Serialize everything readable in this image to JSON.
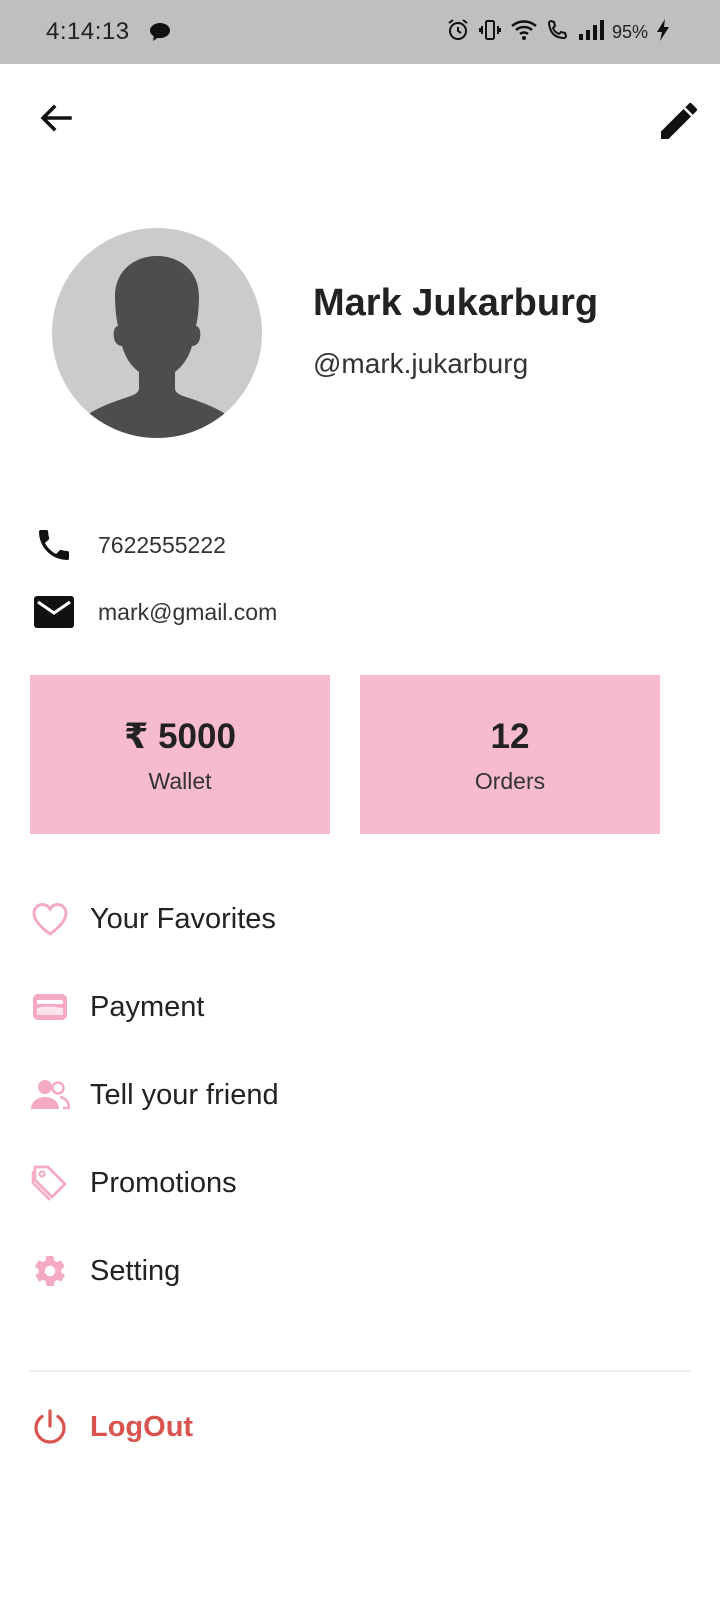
{
  "status_bar": {
    "time": "4:14:13",
    "battery": "95%",
    "icons": [
      "chat-icon",
      "alarm-icon",
      "vibrate-icon",
      "wifi-icon",
      "wifi-call-icon",
      "signal-icon",
      "charging-icon"
    ]
  },
  "app_bar": {
    "back_icon": "arrow-back-icon",
    "edit_icon": "edit-pencil-icon"
  },
  "profile": {
    "name": "Mark Jukarburg",
    "handle": "@mark.jukarburg",
    "avatar_icon": "person-silhouette-icon"
  },
  "contact": {
    "phone": "7622555222",
    "email": "mark@gmail.com"
  },
  "stats": [
    {
      "value": "₹ 5000",
      "label": "Wallet"
    },
    {
      "value": "12",
      "label": "Orders"
    }
  ],
  "menu": [
    {
      "label": "Your Favorites",
      "icon": "heart-outline-icon"
    },
    {
      "label": "Payment",
      "icon": "card-icon"
    },
    {
      "label": "Tell your friend",
      "icon": "people-icon"
    },
    {
      "label": "Promotions",
      "icon": "tag-icon"
    },
    {
      "label": "Setting",
      "icon": "gear-icon"
    }
  ],
  "logout": {
    "label": "LogOut",
    "icon": "power-icon"
  },
  "colors": {
    "accent_pink": "#f7bbd0",
    "icon_pink": "#f4a9c4",
    "logout_red": "#d9534f",
    "status_bar": "#bfbfbf"
  }
}
